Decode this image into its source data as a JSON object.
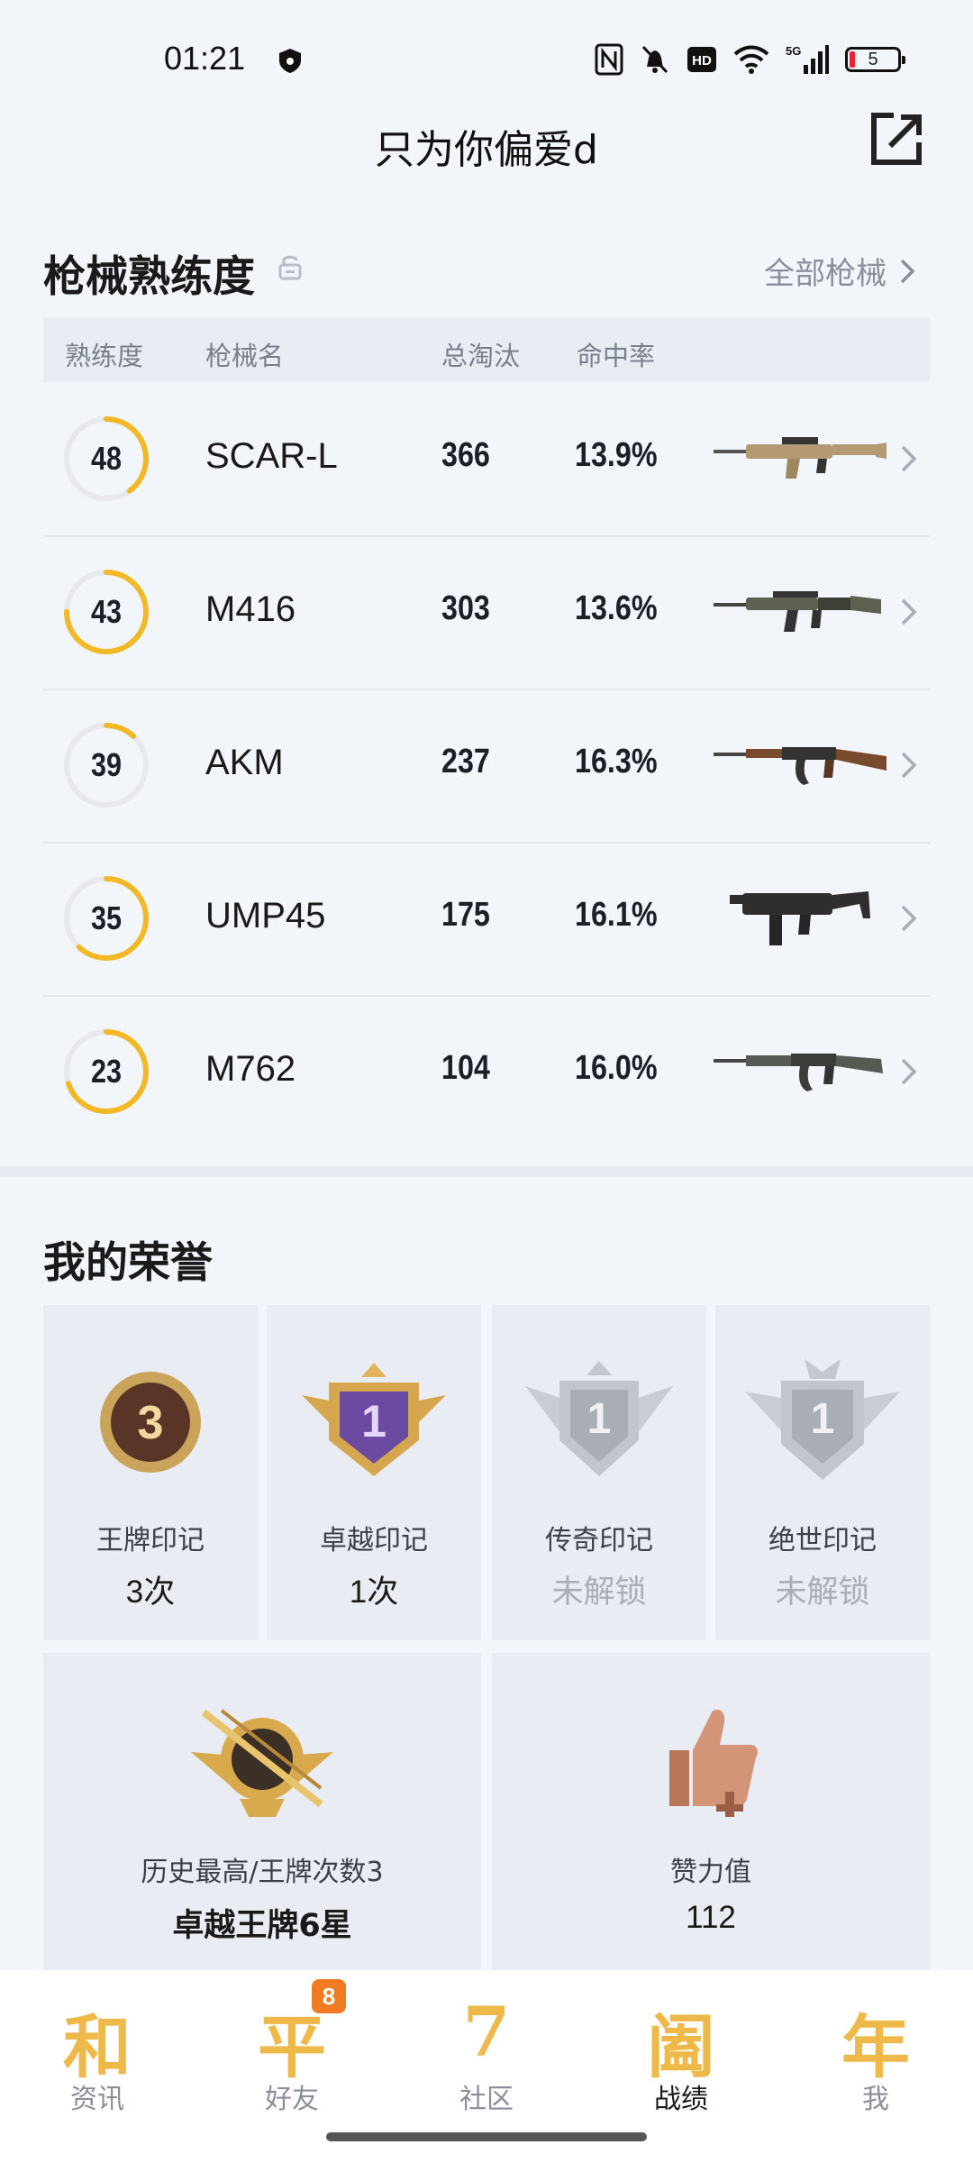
{
  "status_bar": {
    "time": "01:21",
    "network": "5G",
    "battery": "5",
    "icons": [
      "shield-icon",
      "nfc-icon",
      "mute-icon",
      "hd-icon",
      "wifi-icon",
      "signal-icon",
      "battery-icon"
    ]
  },
  "header": {
    "title": "只为你偏爱d",
    "share_icon": "share-icon"
  },
  "weapons": {
    "section_title": "枪械熟练度",
    "all_link": "全部枪械",
    "columns": {
      "proficiency": "熟练度",
      "name": "枪械名",
      "kills": "总淘汰",
      "hit_rate": "命中率"
    },
    "rows": [
      {
        "level": "48",
        "progress": 0.4,
        "name": "SCAR-L",
        "kills": "366",
        "hit_rate": "13.9%",
        "icon": "scar-l-rifle-icon"
      },
      {
        "level": "43",
        "progress": 0.75,
        "name": "M416",
        "kills": "303",
        "hit_rate": "13.6%",
        "icon": "m416-rifle-icon"
      },
      {
        "level": "39",
        "progress": 0.12,
        "name": "AKM",
        "kills": "237",
        "hit_rate": "16.3%",
        "icon": "akm-rifle-icon"
      },
      {
        "level": "35",
        "progress": 0.62,
        "name": "UMP45",
        "kills": "175",
        "hit_rate": "16.1%",
        "icon": "ump45-smg-icon"
      },
      {
        "level": "23",
        "progress": 0.7,
        "name": "M762",
        "kills": "104",
        "hit_rate": "16.0%",
        "icon": "m762-rifle-icon"
      }
    ]
  },
  "honors": {
    "section_title": "我的荣誉",
    "badges": [
      {
        "label": "王牌印记",
        "value": "3次",
        "badge_number": "3",
        "locked": false
      },
      {
        "label": "卓越印记",
        "value": "1次",
        "badge_number": "1",
        "locked": false
      },
      {
        "label": "传奇印记",
        "value": "未解锁",
        "badge_number": "1",
        "locked": true
      },
      {
        "label": "绝世印记",
        "value": "未解锁",
        "badge_number": "1",
        "locked": true
      }
    ],
    "highest": {
      "label": "历史最高/王牌次数3",
      "value": "卓越王牌6星"
    },
    "likes": {
      "label": "赞力值",
      "value": "112"
    }
  },
  "tabbar": {
    "tabs": [
      {
        "glyph": "和",
        "label": "资讯",
        "active": false
      },
      {
        "glyph": "平",
        "label": "好友",
        "active": false,
        "badge": "8"
      },
      {
        "glyph": "7",
        "label": "社区",
        "active": false
      },
      {
        "glyph": "阖",
        "label": "战绩",
        "active": true
      },
      {
        "glyph": "年",
        "label": "我",
        "active": false
      }
    ]
  },
  "colors": {
    "accent": "#f2b826",
    "badge": "#f07b22",
    "background": "#f2f5fa"
  }
}
